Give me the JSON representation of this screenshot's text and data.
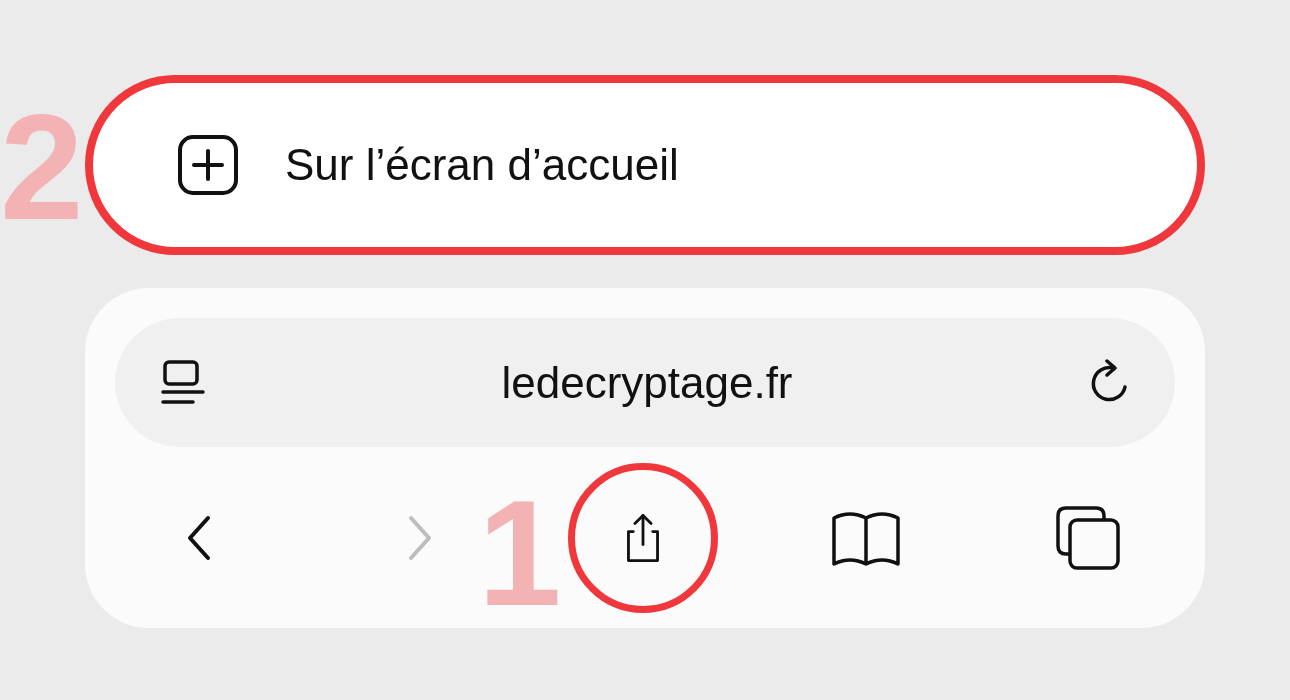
{
  "menu_item": {
    "label": "Sur l’écran d’accueil",
    "highlighted": true
  },
  "url_bar": {
    "url": "ledecryptage.fr"
  },
  "toolbar": [
    {
      "kind": "back",
      "disabled": false,
      "highlighted": false
    },
    {
      "kind": "forward",
      "disabled": true,
      "highlighted": false
    },
    {
      "kind": "share",
      "disabled": false,
      "highlighted": true
    },
    {
      "kind": "bookmarks",
      "disabled": false,
      "highlighted": false
    },
    {
      "kind": "tabs",
      "disabled": false,
      "highlighted": false
    }
  ],
  "annotations": [
    {
      "text": "2"
    },
    {
      "text": "1"
    }
  ]
}
